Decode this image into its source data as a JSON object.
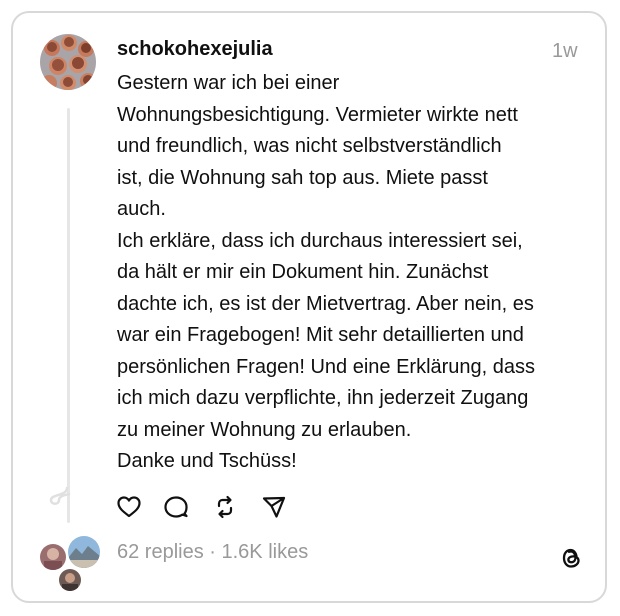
{
  "post": {
    "username": "schokohexejulia",
    "timestamp": "1w",
    "body_lines": [
      "Gestern war ich bei einer",
      "Wohnungsbesichtigung. Vermieter wirkte nett",
      "und freundlich, was nicht selbstverständlich",
      "ist, die Wohnung sah top aus. Miete passt",
      "auch.",
      "Ich erkläre, dass ich durchaus interessiert sei,",
      "da hält er mir ein Dokument hin. Zunächst",
      "dachte ich, es ist der Mietvertrag. Aber nein, es",
      "war ein Fragebogen! Mit sehr detaillierten und",
      "persönlichen Fragen! Und eine Erklärung, dass",
      "ich mich dazu verpflichte, ihn jederzeit Zugang",
      "zu meiner Wohnung zu erlauben.",
      "Danke und Tschüss!"
    ]
  },
  "actions": {
    "icons": [
      "heart-icon",
      "comment-icon",
      "repost-icon",
      "share-icon"
    ]
  },
  "footer": {
    "stats": "62 replies · 1.6K likes",
    "logo": "threads-logo-icon"
  },
  "colors": {
    "text": "#101010",
    "muted": "#999999",
    "border": "#d8d8d8"
  }
}
